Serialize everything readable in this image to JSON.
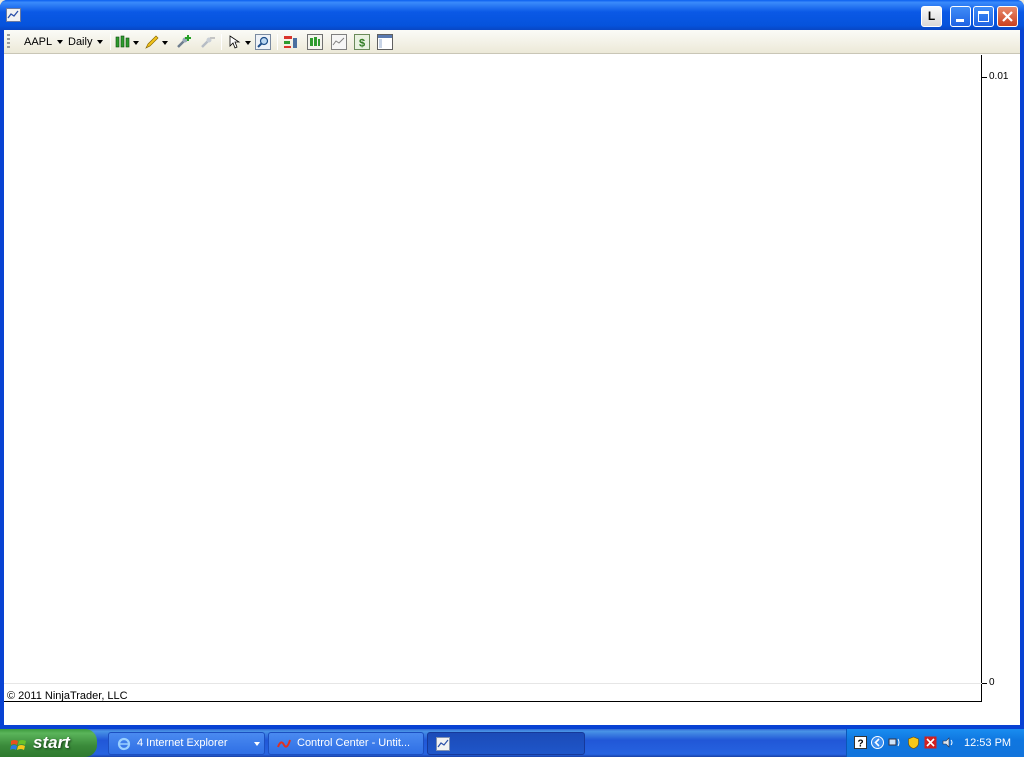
{
  "window": {
    "title": "",
    "buttons": {
      "l_label": "L"
    }
  },
  "toolbar": {
    "instrument": "AAPL",
    "interval": "Daily",
    "icons": [
      "chart-style-icon",
      "drawing-tool-icon",
      "add-indicator-icon",
      "remove-indicator-icon",
      "cursor-icon",
      "zoom-icon",
      "data-box-icon",
      "chart-trader-icon",
      "properties-icon",
      "dollar-icon",
      "templates-icon"
    ]
  },
  "chart": {
    "y_top_label": "0.01",
    "y_bottom_label": "0",
    "copyright": "© 2011 NinjaTrader, LLC"
  },
  "chart_data": {
    "type": "line",
    "x": [],
    "series": [],
    "ylim": [
      0,
      0.01
    ],
    "yticks": [
      "0.01",
      "0"
    ],
    "title": "",
    "xlabel": "",
    "ylabel": ""
  },
  "taskbar": {
    "start_label": "start",
    "tasks": [
      {
        "label": "4 Internet Explorer",
        "icon": "internet-explorer-icon",
        "has_group": true
      },
      {
        "label": "Control Center - Untit...",
        "icon": "ninjatrader-icon",
        "has_group": false
      },
      {
        "label": "",
        "icon": "chart-window-icon",
        "has_group": false,
        "active": true
      }
    ],
    "clock": "12:53 PM",
    "colors": {
      "taskbar": "#245edb",
      "start": "#3c9a3c",
      "tray": "#0f76e0"
    }
  }
}
